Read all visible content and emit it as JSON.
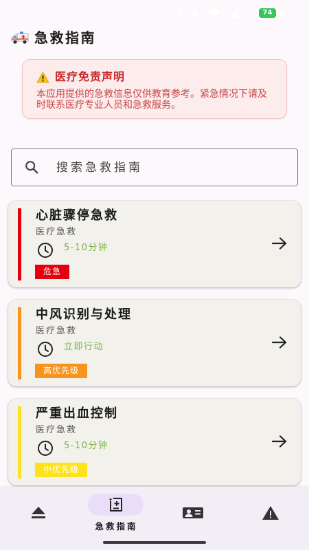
{
  "status_bar": {
    "battery": "74"
  },
  "header": {
    "title": "急救指南",
    "icon": "ambulance-icon"
  },
  "disclaimer": {
    "icon": "warning-icon",
    "title": "医疗免责声明",
    "text": "本应用提供的急救信息仅供教育参考。紧急情况下请及时联系医疗专业人员和急救服务。"
  },
  "search": {
    "icon": "search-icon",
    "placeholder": "搜索急救指南",
    "value": ""
  },
  "guides": [
    {
      "title": "心脏骤停急救",
      "category": "医疗急救",
      "duration": "5-10分钟",
      "priority": "危急",
      "color": "#e3000f",
      "icon": "clock-icon"
    },
    {
      "title": "中风识别与处理",
      "category": "医疗急救",
      "duration": "立即行动",
      "priority": "高优先级",
      "color": "#f7941d",
      "icon": "clock-icon"
    },
    {
      "title": "严重出血控制",
      "category": "医疗急救",
      "duration": "5-10分钟",
      "priority": "中优先级",
      "color": "#fde21d",
      "icon": "clock-icon"
    }
  ],
  "bottom_nav": {
    "items": [
      {
        "icon": "eject-icon",
        "selected": false
      },
      {
        "icon": "add-note-icon",
        "label": "急救指南",
        "selected": true
      },
      {
        "icon": "contact-card-icon",
        "selected": false
      },
      {
        "icon": "warning-icon",
        "selected": false
      }
    ]
  },
  "colors": {
    "background": "#fcf8fb",
    "disclaimer_title": "#c62828",
    "duration_text": "#7cb342",
    "nav_background": "#f3edf6",
    "nav_selected_pill": "#e8def8",
    "battery": "#34c759"
  }
}
